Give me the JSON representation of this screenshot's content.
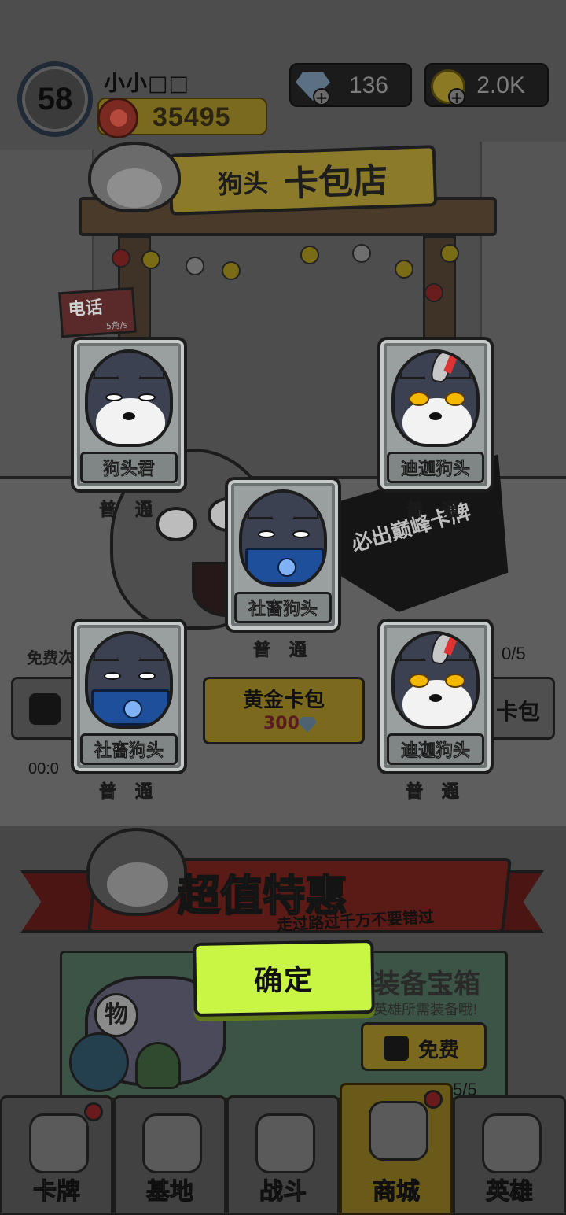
{
  "player": {
    "level": "58",
    "name": "小小□□",
    "power": "35495"
  },
  "currencies": {
    "gems": {
      "icon": "diamond-icon",
      "value": "136"
    },
    "coins": {
      "icon": "gold-coin-icon",
      "value": "2.0K"
    }
  },
  "shop": {
    "sign_small": "狗头",
    "sign_big": "卡包店",
    "phone_sign_title": "电话",
    "phone_sign_sub": "5角/s",
    "slogan": "必出巅峰卡牌",
    "free_label": "免费次",
    "free_count": "0/5",
    "timer": "00:0",
    "gold_pack": {
      "title": "黄金卡包",
      "price": "300"
    },
    "right_pack_label": "卡包"
  },
  "promo": {
    "title": "超值特惠",
    "subtitle": "走过路过千万不要错过",
    "chest_title": "装备宝箱",
    "chest_sub": "英雄所需装备哦!",
    "chest_tag": "物",
    "chest_free": "免费",
    "chest_count": "5/5"
  },
  "reward_cards": [
    {
      "name": "狗头君",
      "rarity": "普 通",
      "variant": "boss"
    },
    {
      "name": "迪迦狗头",
      "rarity": "普 通",
      "variant": "ultra"
    },
    {
      "name": "社畜狗头",
      "rarity": "普 通",
      "variant": "worker"
    },
    {
      "name": "社畜狗头",
      "rarity": "普 通",
      "variant": "worker"
    },
    {
      "name": "迪迦狗头",
      "rarity": "普 通",
      "variant": "ultra"
    }
  ],
  "confirm_label": "确定",
  "bottom_nav": [
    {
      "label": "卡牌",
      "icon": "dog-icon",
      "badge": true,
      "active": false
    },
    {
      "label": "基地",
      "icon": "castle-icon",
      "badge": false,
      "active": false
    },
    {
      "label": "战斗",
      "icon": "paw-icon",
      "badge": false,
      "active": false
    },
    {
      "label": "商城",
      "icon": "money-icon",
      "badge": true,
      "active": true
    },
    {
      "label": "英雄",
      "icon": "hero-icon",
      "badge": false,
      "active": false
    }
  ],
  "colors": {
    "confirm_green": "#c9f545",
    "card_silver": "#9aa0a0",
    "laptop_blue": "#1e4f9a",
    "ultra_eye_gold": "#f5b800"
  }
}
